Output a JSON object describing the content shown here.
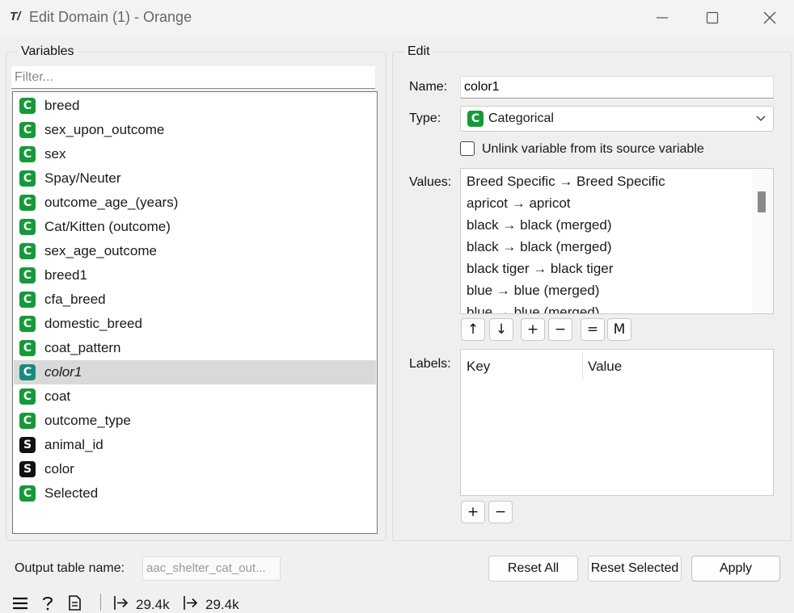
{
  "window": {
    "app_icon": "T/",
    "title": "Edit Domain (1) - Orange",
    "controls": [
      "minimize-icon",
      "maximize-icon",
      "close-icon"
    ]
  },
  "variables_panel": {
    "title": "Variables",
    "filter_placeholder": "Filter...",
    "items": [
      {
        "type": "C",
        "name": "breed"
      },
      {
        "type": "C",
        "name": "sex_upon_outcome"
      },
      {
        "type": "C",
        "name": "sex"
      },
      {
        "type": "C",
        "name": "Spay/Neuter"
      },
      {
        "type": "C",
        "name": "outcome_age_(years)"
      },
      {
        "type": "C",
        "name": "Cat/Kitten (outcome)"
      },
      {
        "type": "C",
        "name": "sex_age_outcome"
      },
      {
        "type": "C",
        "name": "breed1"
      },
      {
        "type": "C",
        "name": "cfa_breed"
      },
      {
        "type": "C",
        "name": "domestic_breed"
      },
      {
        "type": "C",
        "name": "coat_pattern"
      },
      {
        "type": "C",
        "name": "color1",
        "selected": true
      },
      {
        "type": "C",
        "name": "coat"
      },
      {
        "type": "C",
        "name": "outcome_type"
      },
      {
        "type": "S",
        "name": "animal_id"
      },
      {
        "type": "S",
        "name": "color"
      },
      {
        "type": "C",
        "name": "Selected"
      }
    ]
  },
  "edit_panel": {
    "title": "Edit",
    "name_label": "Name:",
    "name_value": "color1",
    "type_label": "Type:",
    "type_badge": "C",
    "type_value": "Categorical",
    "unlink_label": "Unlink variable from its source variable",
    "unlink_checked": false,
    "values_label": "Values:",
    "values": [
      "Breed Specific → Breed Specific",
      "apricot → apricot",
      "black → black (merged)",
      "black  → black (merged)",
      "black tiger → black tiger",
      "blue → blue (merged)",
      "blue  → blue (merged)"
    ],
    "value_buttons": [
      "↑",
      "↓",
      "+",
      "−",
      "=",
      "M"
    ],
    "labels_label": "Labels:",
    "labels_columns": [
      "Key",
      "Value"
    ],
    "label_buttons": [
      "+",
      "−"
    ]
  },
  "footer": {
    "output_label": "Output table name:",
    "output_value": "aac_shelter_cat_out...",
    "buttons": {
      "reset_all": "Reset All",
      "reset_selected": "Reset Selected",
      "apply": "Apply"
    }
  },
  "statusbar": {
    "input_count": "29.4k",
    "output_count": "29.4k"
  },
  "colors": {
    "categorical": "#169a39",
    "string": "#111111",
    "selected_row": "#d9d9d9"
  }
}
